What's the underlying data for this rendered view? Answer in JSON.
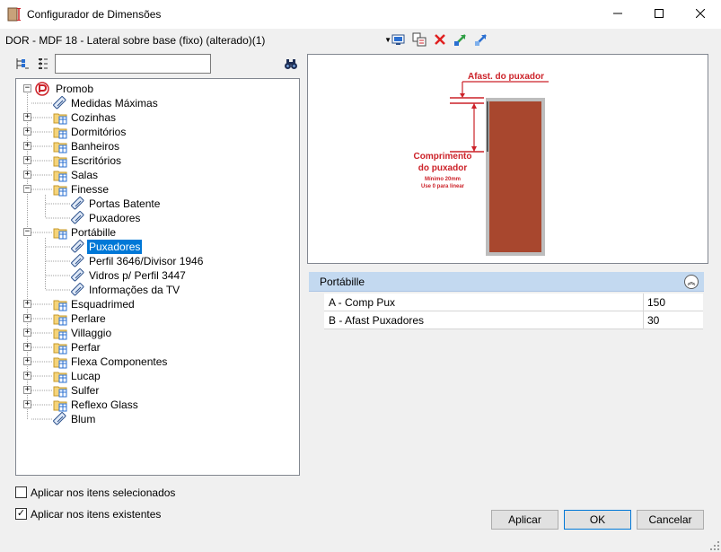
{
  "window": {
    "title": "Configurador de Dimensões",
    "minimize_icon": "minimize-icon",
    "maximize_icon": "maximize-icon",
    "close_icon": "close-icon"
  },
  "toolbar": {
    "document_selected": "DOR - MDF 18 - Lateral sobre base (fixo) (alterado)(1)",
    "icons": [
      "monitor-icon",
      "copy-paste-icon",
      "delete-icon",
      "expand-green-icon",
      "expand-blue-icon"
    ]
  },
  "tree_toolbar": {
    "search_value": "",
    "icons": [
      "tree-collapse-icon",
      "tree-list-icon",
      "binoculars-icon"
    ]
  },
  "tree": {
    "root": "Promob",
    "items": [
      {
        "label": "Medidas Máximas",
        "level": 1,
        "type": "leaf"
      },
      {
        "label": "Cozinhas",
        "level": 1,
        "type": "folder",
        "expanded": false
      },
      {
        "label": "Dormitórios",
        "level": 1,
        "type": "folder",
        "expanded": false
      },
      {
        "label": "Banheiros",
        "level": 1,
        "type": "folder",
        "expanded": false
      },
      {
        "label": "Escritórios",
        "level": 1,
        "type": "folder",
        "expanded": false
      },
      {
        "label": "Salas",
        "level": 1,
        "type": "folder",
        "expanded": false
      },
      {
        "label": "Finesse",
        "level": 1,
        "type": "folder",
        "expanded": true
      },
      {
        "label": "Portas Batente",
        "level": 2,
        "type": "leaf"
      },
      {
        "label": "Puxadores",
        "level": 2,
        "type": "leaf"
      },
      {
        "label": "Portábille",
        "level": 1,
        "type": "folder",
        "expanded": true
      },
      {
        "label": "Puxadores",
        "level": 2,
        "type": "leaf",
        "selected": true
      },
      {
        "label": "Perfil 3646/Divisor 1946",
        "level": 2,
        "type": "leaf"
      },
      {
        "label": "Vidros p/ Perfil 3447",
        "level": 2,
        "type": "leaf"
      },
      {
        "label": "Informações da TV",
        "level": 2,
        "type": "leaf"
      },
      {
        "label": "Esquadrimed",
        "level": 1,
        "type": "folder",
        "expanded": false
      },
      {
        "label": "Perlare",
        "level": 1,
        "type": "folder",
        "expanded": false
      },
      {
        "label": "Villaggio",
        "level": 1,
        "type": "folder",
        "expanded": false
      },
      {
        "label": "Perfar",
        "level": 1,
        "type": "folder",
        "expanded": false
      },
      {
        "label": "Flexa Componentes",
        "level": 1,
        "type": "folder",
        "expanded": false
      },
      {
        "label": "Lucap",
        "level": 1,
        "type": "folder",
        "expanded": false
      },
      {
        "label": "Sulfer",
        "level": 1,
        "type": "folder",
        "expanded": false
      },
      {
        "label": "Reflexo Glass",
        "level": 1,
        "type": "folder",
        "expanded": false
      },
      {
        "label": "Blum",
        "level": 1,
        "type": "leaf"
      }
    ]
  },
  "preview": {
    "label_afast": "Afast. do puxador",
    "label_comp_1": "Comprimento",
    "label_comp_2": "do puxador",
    "label_min": "Mínimo 20mm",
    "label_zero": "Use 0 para linear",
    "accent_color": "#cc2229",
    "door_color": "#a8472e"
  },
  "properties": {
    "section_title": "Portábille",
    "rows": [
      {
        "name": "A -  Comp Pux",
        "value": "150"
      },
      {
        "name": "B -  Afast Puxadores",
        "value": "30"
      }
    ]
  },
  "options": {
    "apply_selected": {
      "label": "Aplicar nos itens selecionados",
      "checked": false
    },
    "apply_existing": {
      "label": "Aplicar nos itens existentes",
      "checked": true
    }
  },
  "buttons": {
    "apply": "Aplicar",
    "ok": "OK",
    "cancel": "Cancelar"
  }
}
